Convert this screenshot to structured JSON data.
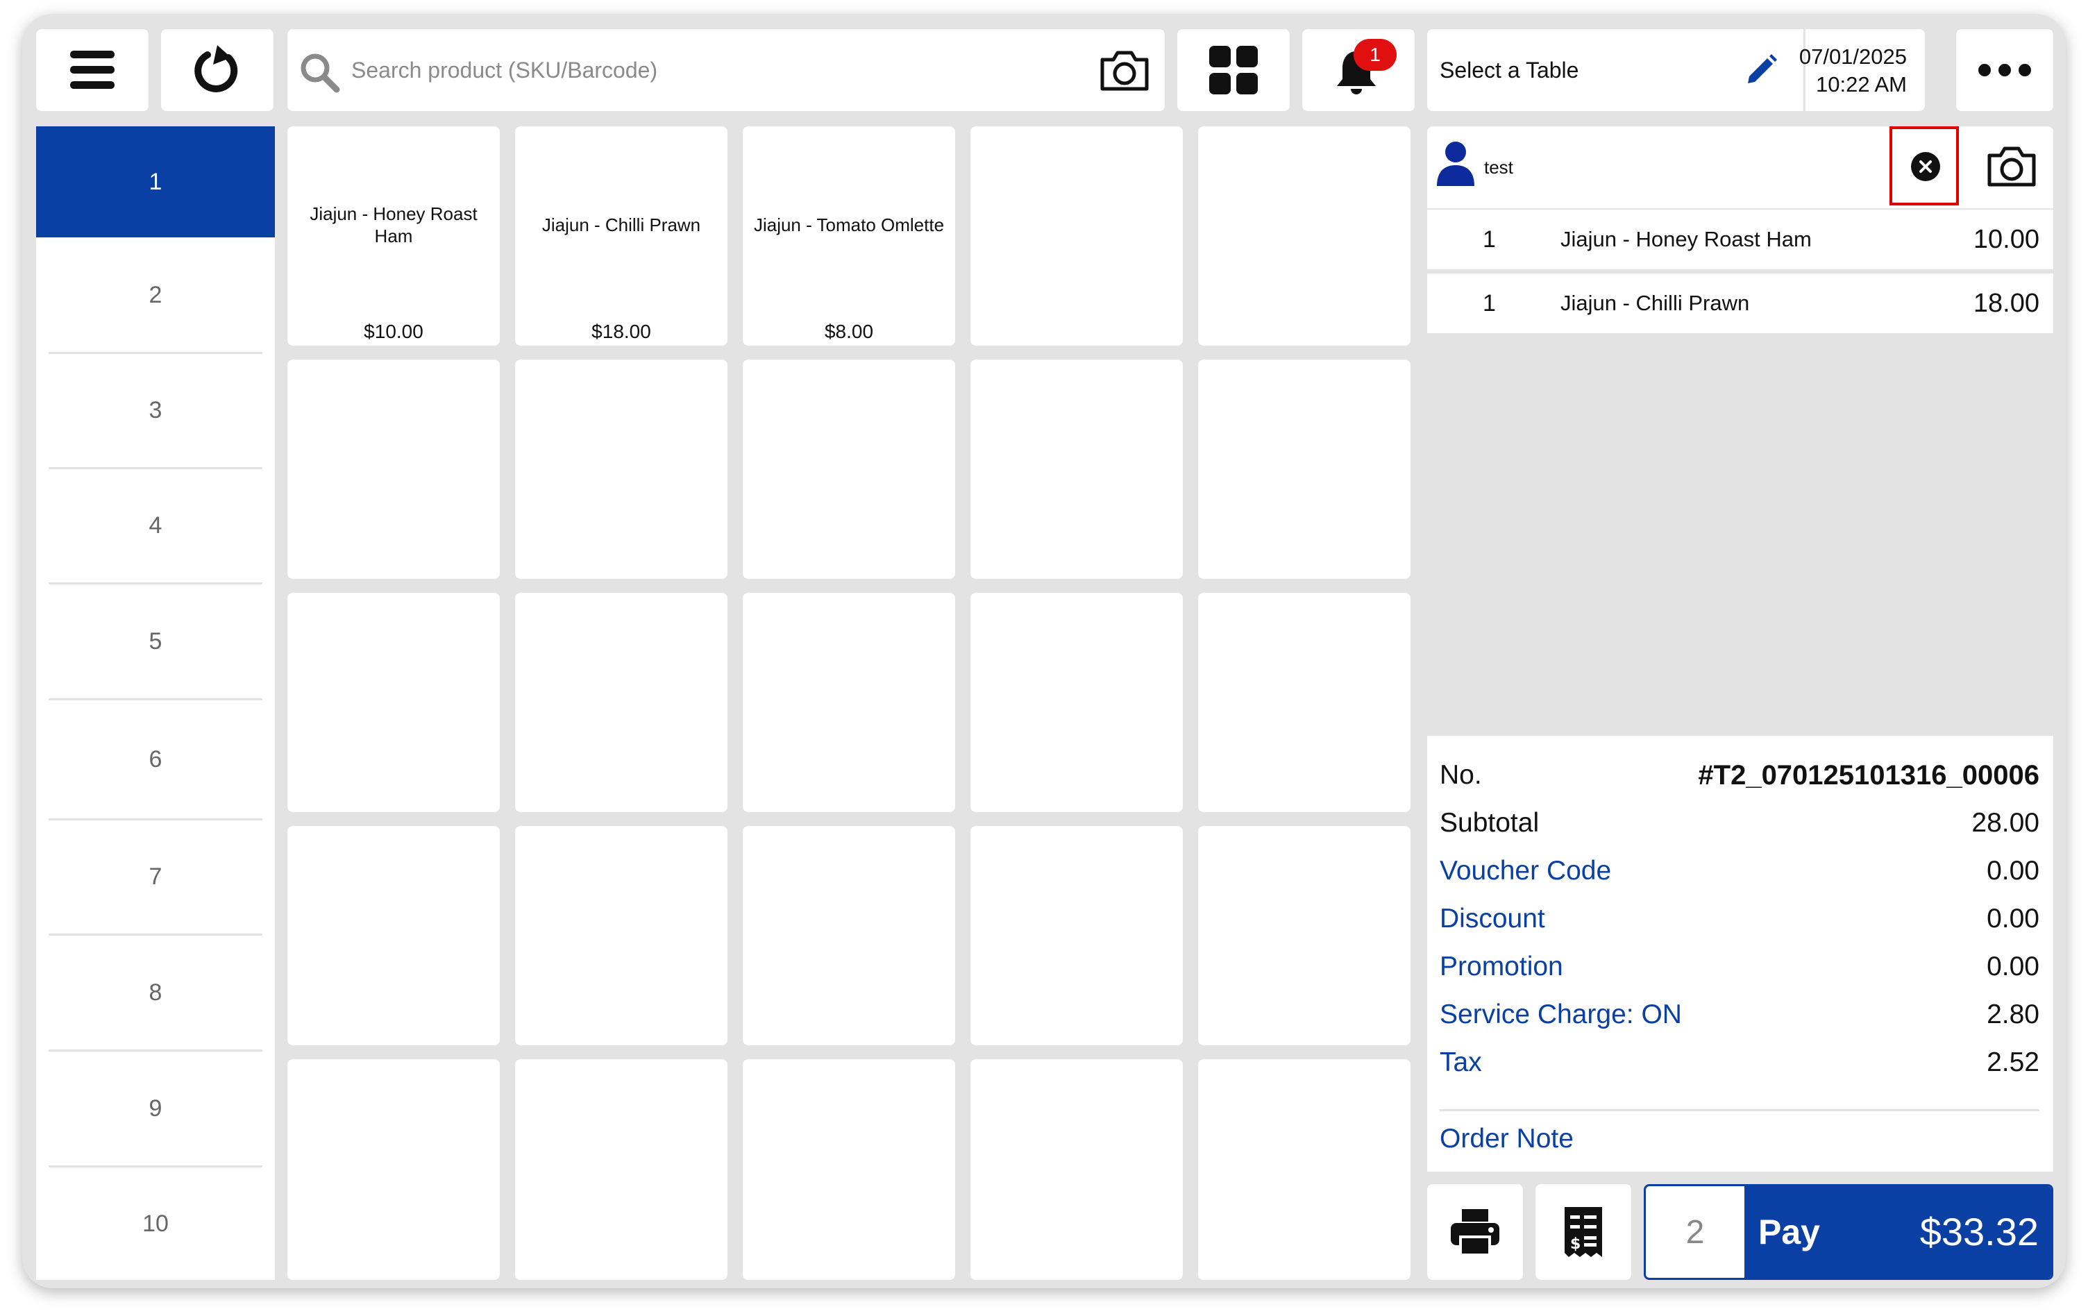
{
  "topbar": {
    "search_placeholder": "Search product (SKU/Barcode)",
    "notification_count": "1",
    "table_select": "Select a Table",
    "date": "07/01/2025",
    "time": "10:22 AM"
  },
  "categories": [
    "1",
    "2",
    "3",
    "4",
    "5",
    "6",
    "7",
    "8",
    "9",
    "10"
  ],
  "products": [
    {
      "name": "Jiajun - Honey Roast Ham",
      "price": "$10.00"
    },
    {
      "name": "Jiajun - Chilli Prawn",
      "price": "$18.00"
    },
    {
      "name": "Jiajun - Tomato Omlette",
      "price": "$8.00"
    }
  ],
  "customer": {
    "name": "test"
  },
  "order_lines": [
    {
      "qty": "1",
      "name": "Jiajun - Honey Roast Ham",
      "price": "10.00"
    },
    {
      "qty": "1",
      "name": "Jiajun - Chilli Prawn",
      "price": "18.00"
    }
  ],
  "summary": {
    "order_no_label": "No.",
    "order_no": "#T2_070125101316_00006",
    "subtotal_label": "Subtotal",
    "subtotal": "28.00",
    "voucher_label": "Voucher Code",
    "voucher": "0.00",
    "discount_label": "Discount",
    "discount": "0.00",
    "promotion_label": "Promotion",
    "promotion": "0.00",
    "service_label": "Service Charge: ON",
    "service": "2.80",
    "tax_label": "Tax",
    "tax": "2.52",
    "order_note_label": "Order Note"
  },
  "payment": {
    "item_count": "2",
    "pay_label": "Pay",
    "total": "$33.32"
  },
  "colors": {
    "accent": "#0a3fa3",
    "badge": "#e01010",
    "highlight_border": "#e00000",
    "background": "#e3e3e3"
  }
}
